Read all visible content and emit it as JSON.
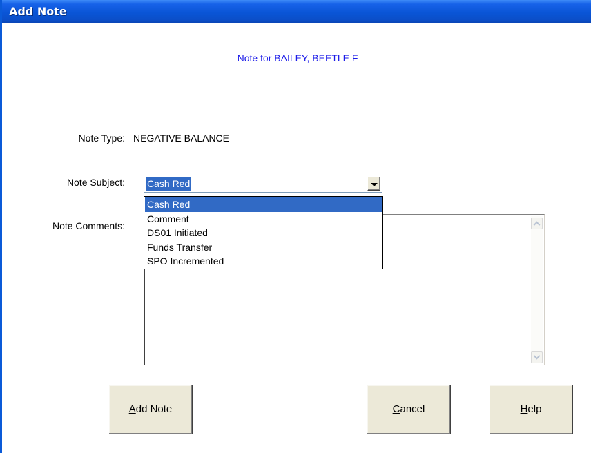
{
  "window": {
    "title": "Add Note"
  },
  "header": {
    "note_for": "Note for BAILEY, BEETLE F"
  },
  "form": {
    "note_type_label": "Note Type:",
    "note_type_value": "NEGATIVE BALANCE",
    "note_subject_label": "Note Subject:",
    "note_subject_value": "Cash Red",
    "note_subject_options": [
      "Cash Red",
      "Comment",
      "DS01 Initiated",
      "Funds Transfer",
      "SPO Incremented"
    ],
    "note_comments_label": "Note Comments:",
    "note_comments_value": ""
  },
  "buttons": {
    "add_note": {
      "accel": "A",
      "rest": "dd Note"
    },
    "cancel": {
      "accel": "C",
      "rest": "ancel"
    },
    "help": {
      "accel": "H",
      "rest": "elp"
    }
  },
  "colors": {
    "title_bar": "#0a55d6",
    "selection": "#316ac5",
    "header_text": "#1a1ae8",
    "button_face": "#ece9d8"
  }
}
